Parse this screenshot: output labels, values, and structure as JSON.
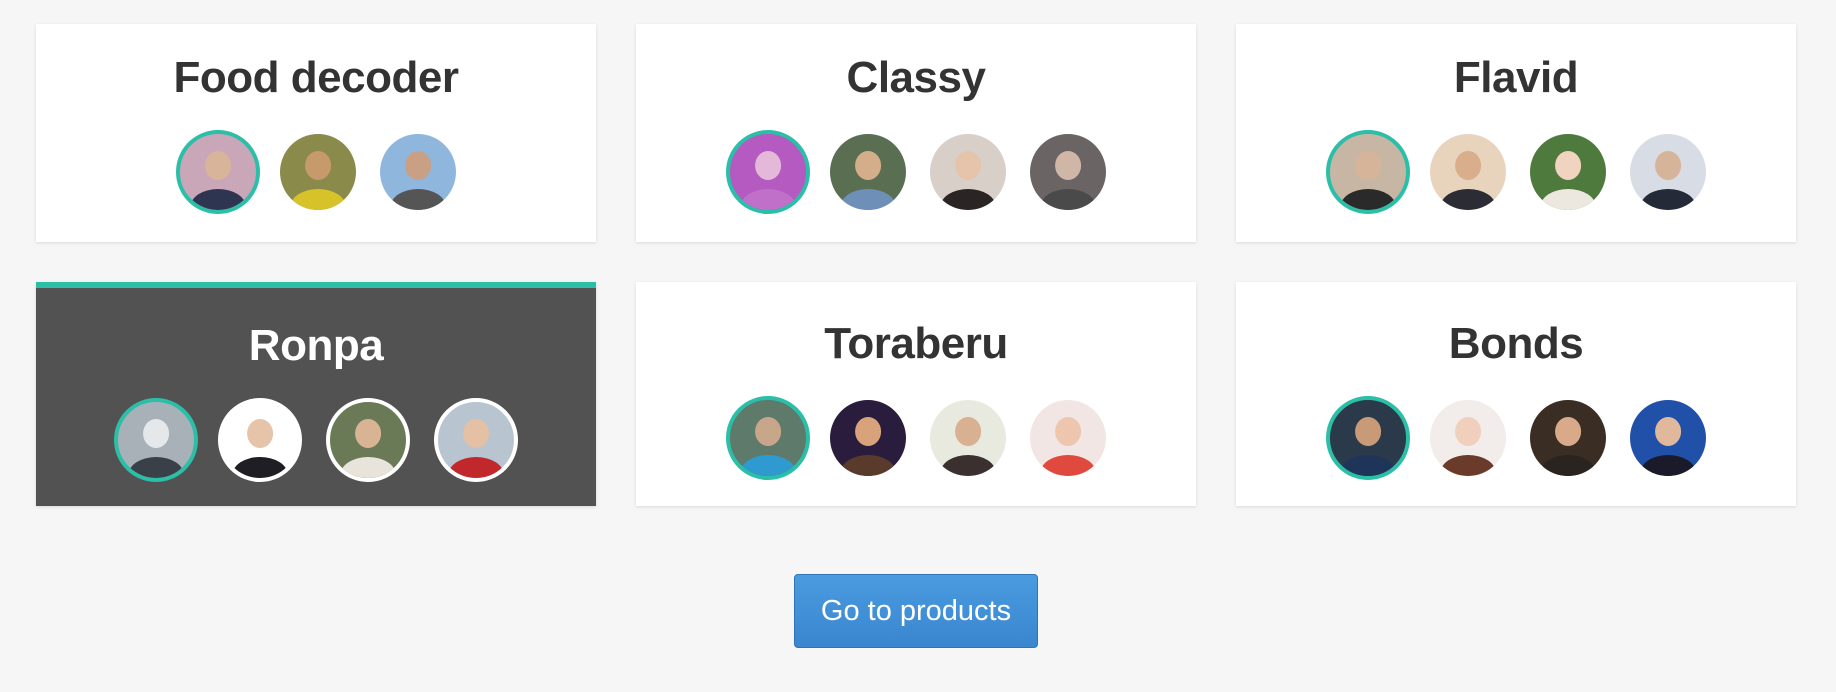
{
  "teams": [
    {
      "name": "Food decoder",
      "avatars": [
        {
          "bg": "#c9a6b8",
          "skin": "#d8b49a",
          "shirt": "#2d3550"
        },
        {
          "bg": "#8a8a4a",
          "skin": "#c69a6a",
          "shirt": "#d8c22a"
        },
        {
          "bg": "#8fb7dd",
          "skin": "#caa084",
          "shirt": "#555555"
        }
      ]
    },
    {
      "name": "Classy",
      "avatars": [
        {
          "bg": "#b45ac0",
          "skin": "#e4b8d8",
          "shirt": "#c070c8"
        },
        {
          "bg": "#5a6e52",
          "skin": "#d4ad8a",
          "shirt": "#6e8fb8"
        },
        {
          "bg": "#d8cfc8",
          "skin": "#e6c4ac",
          "shirt": "#2a2424"
        },
        {
          "bg": "#6a6464",
          "skin": "#cfb6a6",
          "shirt": "#4a4a4a"
        }
      ]
    },
    {
      "name": "Flavid",
      "avatars": [
        {
          "bg": "#c8b6a4",
          "skin": "#d6b49a",
          "shirt": "#2a2a2a"
        },
        {
          "bg": "#e8d4bc",
          "skin": "#d8ae8c",
          "shirt": "#2c2c34"
        },
        {
          "bg": "#4e7a3e",
          "skin": "#f0d4c0",
          "shirt": "#ece8e0"
        },
        {
          "bg": "#d8dce4",
          "skin": "#d6b49a",
          "shirt": "#242a38"
        }
      ]
    },
    {
      "name": "Ronpa",
      "active": true,
      "avatars": [
        {
          "bg": "#a8b0b8",
          "skin": "#e4e8ea",
          "shirt": "#3a4048"
        },
        {
          "bg": "#ffffff",
          "skin": "#e6c4aa",
          "shirt": "#1e1e24"
        },
        {
          "bg": "#6a7a56",
          "skin": "#d8b494",
          "shirt": "#e8e4dc"
        },
        {
          "bg": "#b8c4d0",
          "skin": "#e4c0a4",
          "shirt": "#c0282c"
        }
      ]
    },
    {
      "name": "Toraberu",
      "avatars": [
        {
          "bg": "#5e7a6a",
          "skin": "#c8a68a",
          "shirt": "#2f9ad0"
        },
        {
          "bg": "#2a1c3c",
          "skin": "#d8a27a",
          "shirt": "#5a3a2a"
        },
        {
          "bg": "#e8eae0",
          "skin": "#d8b092",
          "shirt": "#3a3030"
        },
        {
          "bg": "#f2e6e4",
          "skin": "#eec6ae",
          "shirt": "#e04a3e"
        }
      ]
    },
    {
      "name": "Bonds",
      "avatars": [
        {
          "bg": "#2a3a4a",
          "skin": "#c89a78",
          "shirt": "#1e3458"
        },
        {
          "bg": "#f2ecea",
          "skin": "#f0d0bc",
          "shirt": "#6a3a2a"
        },
        {
          "bg": "#3a2e24",
          "skin": "#d8aa8a",
          "shirt": "#2a2420"
        },
        {
          "bg": "#2050a8",
          "skin": "#e0b89c",
          "shirt": "#1a1a2a"
        }
      ]
    }
  ],
  "button": {
    "label": "Go to products"
  },
  "colors": {
    "accent": "#2bbfa8",
    "button": "#3f8fd8",
    "active_card": "#525252"
  }
}
